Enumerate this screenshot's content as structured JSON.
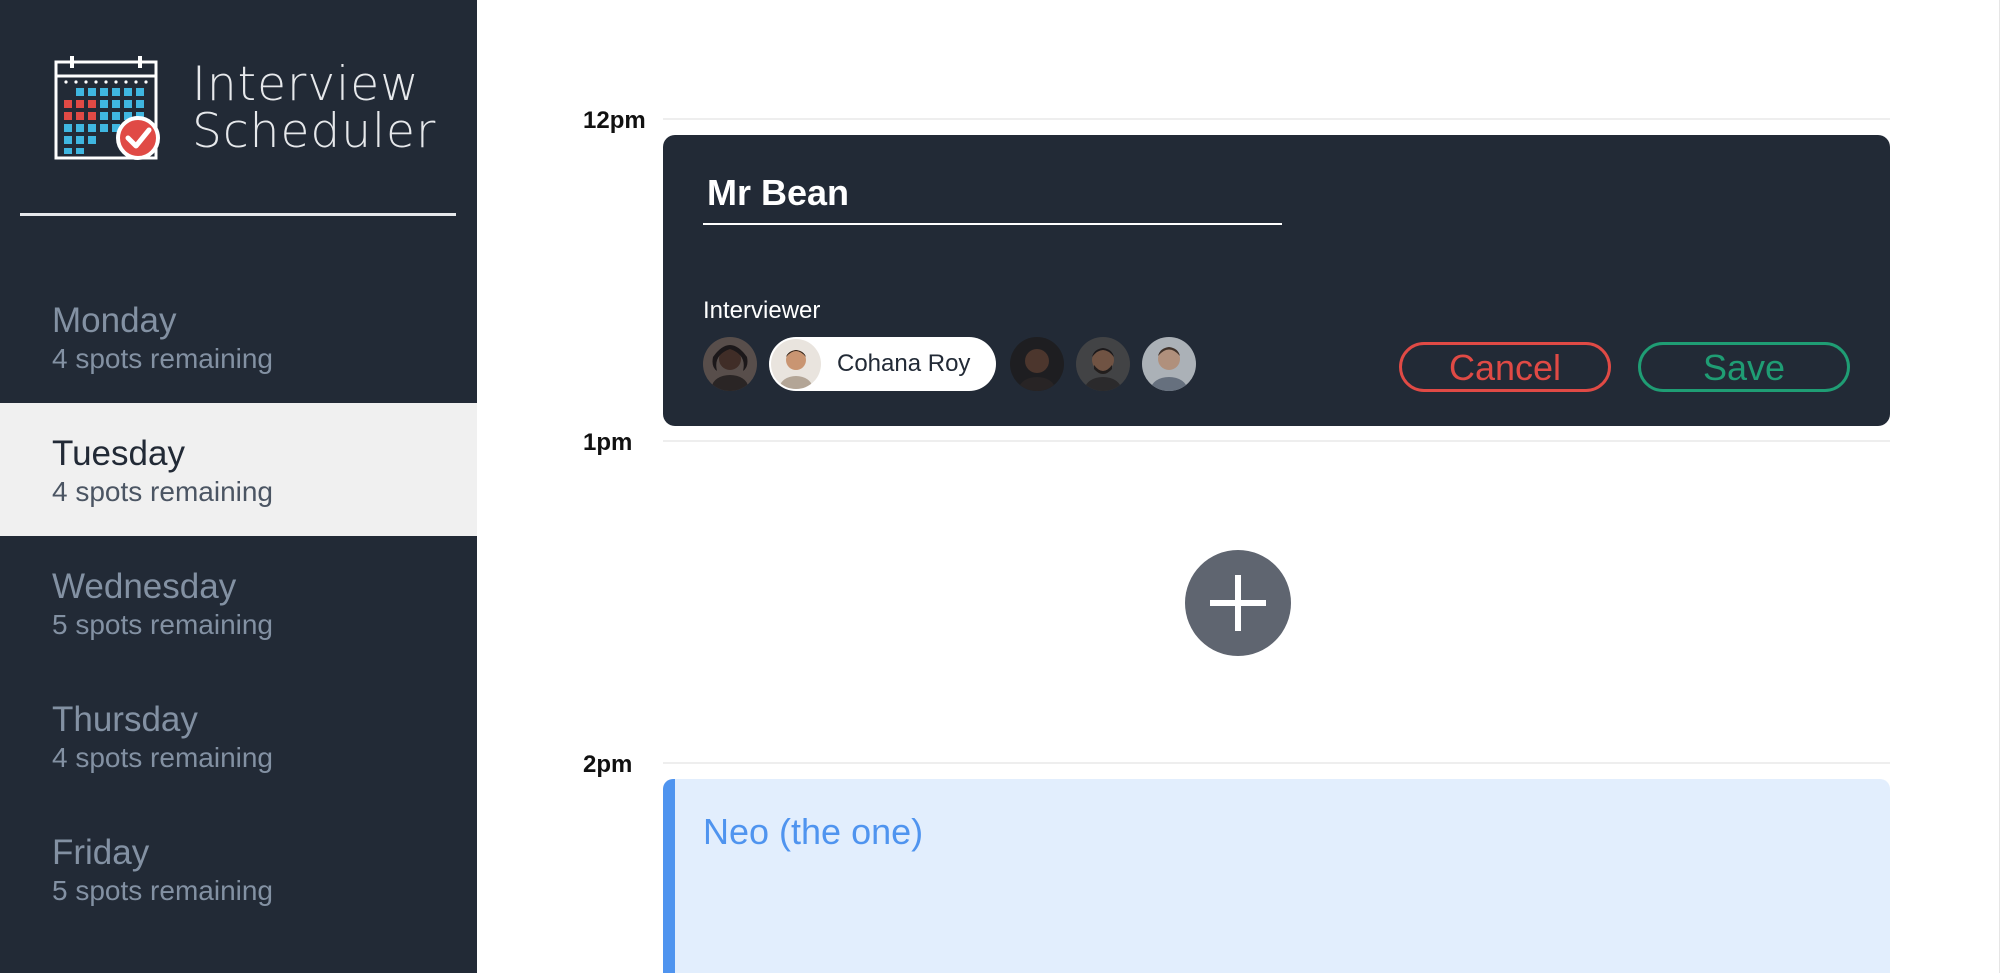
{
  "brand": {
    "title_line1": "Interview",
    "title_line2": "Scheduler"
  },
  "sidebar": {
    "days": [
      {
        "name": "Monday",
        "spots": "4 spots remaining",
        "selected": false
      },
      {
        "name": "Tuesday",
        "spots": "4 spots remaining",
        "selected": true
      },
      {
        "name": "Wednesday",
        "spots": "5 spots remaining",
        "selected": false
      },
      {
        "name": "Thursday",
        "spots": "4 spots remaining",
        "selected": false
      },
      {
        "name": "Friday",
        "spots": "5 spots remaining",
        "selected": false
      }
    ]
  },
  "schedule": {
    "times": [
      "12pm",
      "1pm",
      "2pm"
    ],
    "form": {
      "student_name": "Mr Bean",
      "interviewer_label": "Interviewer",
      "selected_interviewer": "Cohana Roy",
      "cancel_label": "Cancel",
      "save_label": "Save"
    },
    "appointment": {
      "student": "Neo (the one)"
    }
  },
  "colors": {
    "sidebar_bg": "#222a36",
    "cancel": "#e04a45",
    "save": "#1f9d74",
    "appointment_accent": "#4f94ef",
    "add_button": "#5f6570"
  },
  "icons": {
    "logo": "calendar-check-icon",
    "add": "plus-icon"
  }
}
